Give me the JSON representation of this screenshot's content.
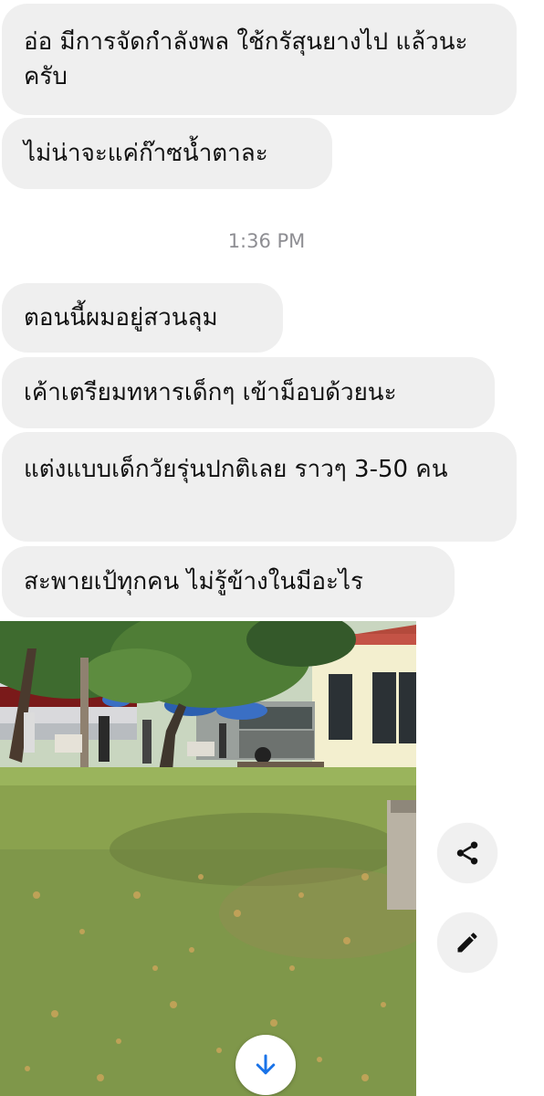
{
  "messages": [
    {
      "text": "อ่อ มีการจัดกำลังพล ใช้กรัสุนยางไป แล้วนะครับ"
    },
    {
      "text": "ไม่น่าจะแค่ก๊าซน้ำตาละ"
    },
    {
      "text": "ตอนนี้ผมอยู่สวนลุม"
    },
    {
      "text": "เค้าเตรียมทหารเด็กๆ เข้าม็อบด้วยนะ"
    },
    {
      "text": "แต่งแบบเด็กวัยรุ่นปกติเลย ราวๆ 3-50 คน"
    },
    {
      "text": "สะพายเป้ทุกคน ไม่รู้ข้างในมีอะไร"
    }
  ],
  "timestamp": "1:36 PM",
  "photo": {
    "description_icon": "park-photo"
  },
  "actions": {
    "share_icon": "share-icon",
    "edit_icon": "pencil-icon",
    "scroll_icon": "arrow-down-icon"
  },
  "colors": {
    "bubble_bg": "#efefef",
    "text": "#111111",
    "timestamp": "#8e8e93",
    "accent": "#1a73e8"
  }
}
